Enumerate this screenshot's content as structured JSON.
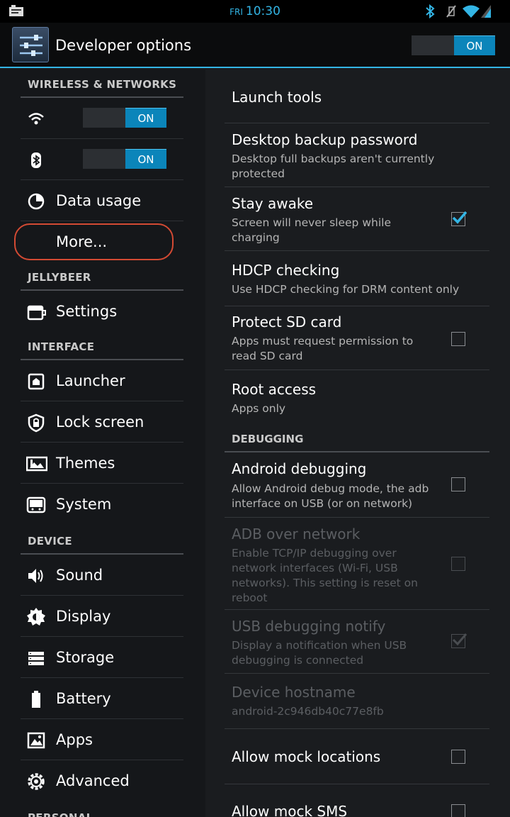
{
  "status_bar": {
    "day": "FRI",
    "time": "10:30"
  },
  "action_bar": {
    "title": "Developer options",
    "master_toggle": "ON"
  },
  "left_nav": {
    "sections": {
      "wireless": "WIRELESS & NETWORKS",
      "jellybeer": "JELLYBEER",
      "interface": "INTERFACE",
      "device": "DEVICE",
      "personal": "PERSONAL"
    },
    "wifi_toggle": "ON",
    "bluetooth_toggle": "ON",
    "items": {
      "data_usage": "Data usage",
      "more": "More...",
      "settings": "Settings",
      "launcher": "Launcher",
      "lock_screen": "Lock screen",
      "themes": "Themes",
      "system": "System",
      "sound": "Sound",
      "display": "Display",
      "storage": "Storage",
      "battery": "Battery",
      "apps": "Apps",
      "advanced": "Advanced"
    }
  },
  "right_pane": {
    "launch_tools": "Launch tools",
    "desktop_backup": {
      "title": "Desktop backup password",
      "summary": "Desktop full backups aren't currently protected"
    },
    "stay_awake": {
      "title": "Stay awake",
      "summary": "Screen will never sleep while charging",
      "checked": true
    },
    "hdcp": {
      "title": "HDCP checking",
      "summary": "Use HDCP checking for DRM content only"
    },
    "protect_sd": {
      "title": "Protect SD card",
      "summary": "Apps must request permission to read SD card",
      "checked": false
    },
    "root_access": {
      "title": "Root access",
      "summary": "Apps only"
    },
    "debugging_header": "DEBUGGING",
    "android_debugging": {
      "title": "Android debugging",
      "summary": "Allow Android debug mode, the adb interface on USB (or on network)",
      "checked": false
    },
    "adb_network": {
      "title": "ADB over network",
      "summary": "Enable TCP/IP debugging over network interfaces (Wi-Fi, USB networks). This setting is reset on reboot",
      "enabled": false
    },
    "usb_notify": {
      "title": "USB debugging notify",
      "summary": "Display a notification when USB debugging is connected",
      "enabled": false,
      "checked": true
    },
    "hostname": {
      "title": "Device hostname",
      "summary": "android-2c946db40c77e8fb",
      "enabled": false
    },
    "mock_locations": {
      "title": "Allow mock locations",
      "checked": false
    },
    "mock_sms": {
      "title": "Allow mock SMS",
      "checked": false
    }
  },
  "colors": {
    "accent": "#33b5e5",
    "highlight_outline": "#d34a33"
  }
}
